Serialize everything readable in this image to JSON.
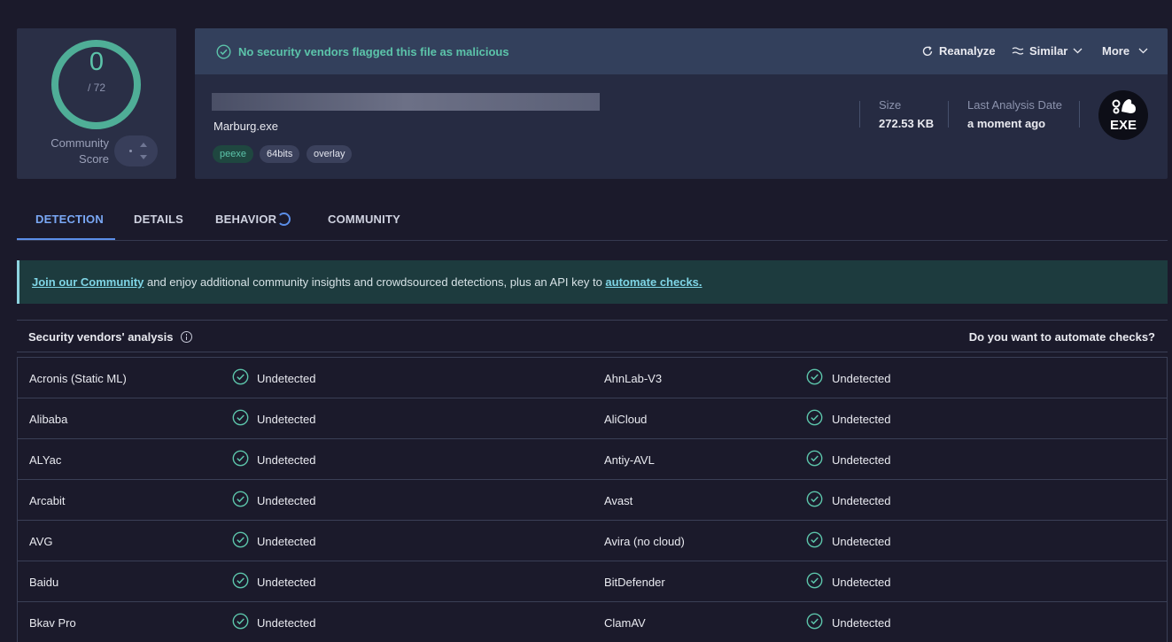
{
  "score": {
    "detections": "0",
    "total": "/ 72",
    "community_label_1": "Community",
    "community_label_2": "Score"
  },
  "summary": {
    "status_message": "No security vendors flagged this file as malicious",
    "actions": {
      "reanalyze": "Reanalyze",
      "similar": "Similar",
      "more": "More"
    },
    "file_name": "Marburg.exe",
    "tags": [
      "peexe",
      "64bits",
      "overlay"
    ],
    "size_label": "Size",
    "size_value": "272.53 KB",
    "date_label": "Last Analysis Date",
    "date_value": "a moment ago",
    "file_type_badge": "EXE"
  },
  "tabs": [
    "DETECTION",
    "DETAILS",
    "BEHAVIOR",
    "COMMUNITY"
  ],
  "banner": {
    "link1": "Join our Community",
    "middle_text": " and enjoy additional community insights and crowdsourced detections, plus an API key to ",
    "link2": "automate checks."
  },
  "vendors": {
    "title": "Security vendors' analysis",
    "automate_question": "Do you want to automate checks?",
    "rows": [
      {
        "left_name": "Acronis (Static ML)",
        "left_status": "Undetected",
        "right_name": "AhnLab-V3",
        "right_status": "Undetected"
      },
      {
        "left_name": "Alibaba",
        "left_status": "Undetected",
        "right_name": "AliCloud",
        "right_status": "Undetected"
      },
      {
        "left_name": "ALYac",
        "left_status": "Undetected",
        "right_name": "Antiy-AVL",
        "right_status": "Undetected"
      },
      {
        "left_name": "Arcabit",
        "left_status": "Undetected",
        "right_name": "Avast",
        "right_status": "Undetected"
      },
      {
        "left_name": "AVG",
        "left_status": "Undetected",
        "right_name": "Avira (no cloud)",
        "right_status": "Undetected"
      },
      {
        "left_name": "Baidu",
        "left_status": "Undetected",
        "right_name": "BitDefender",
        "right_status": "Undetected"
      },
      {
        "left_name": "Bkav Pro",
        "left_status": "Undetected",
        "right_name": "ClamAV",
        "right_status": "Undetected"
      }
    ]
  },
  "colors": {
    "accent_green": "#5cc4aa",
    "accent_blue": "#5b8ee8",
    "background": "#1b1a2b"
  }
}
